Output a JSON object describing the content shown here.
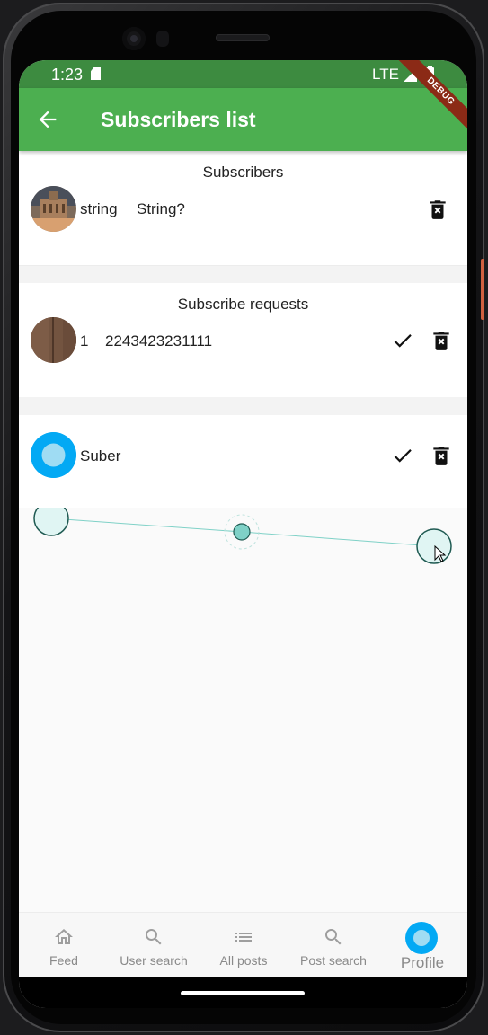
{
  "status_bar": {
    "time": "1:23",
    "network": "LTE"
  },
  "app_bar": {
    "title": "Subscribers list",
    "ribbon": "DEBUG"
  },
  "subscribers": {
    "heading": "Subscribers",
    "items": [
      {
        "name": "string",
        "detail": "String?"
      }
    ]
  },
  "requests": {
    "heading": "Subscribe requests",
    "items": [
      {
        "name": "1",
        "detail": "2243423231111"
      },
      {
        "name": "Suber",
        "detail": ""
      }
    ]
  },
  "bottom_nav": {
    "items": [
      {
        "label": "Feed",
        "icon": "home-icon",
        "active": false
      },
      {
        "label": "User search",
        "icon": "search-icon",
        "active": false
      },
      {
        "label": "All posts",
        "icon": "list-icon",
        "active": false
      },
      {
        "label": "Post search",
        "icon": "search-icon",
        "active": false
      },
      {
        "label": "Profile",
        "icon": "profile-avatar-icon",
        "active": true
      }
    ]
  },
  "colors": {
    "primary": "#4caf50",
    "status_bar": "#3d8b40",
    "accent_blue": "#03a9f4",
    "teal_line": "#7fd1c7"
  }
}
